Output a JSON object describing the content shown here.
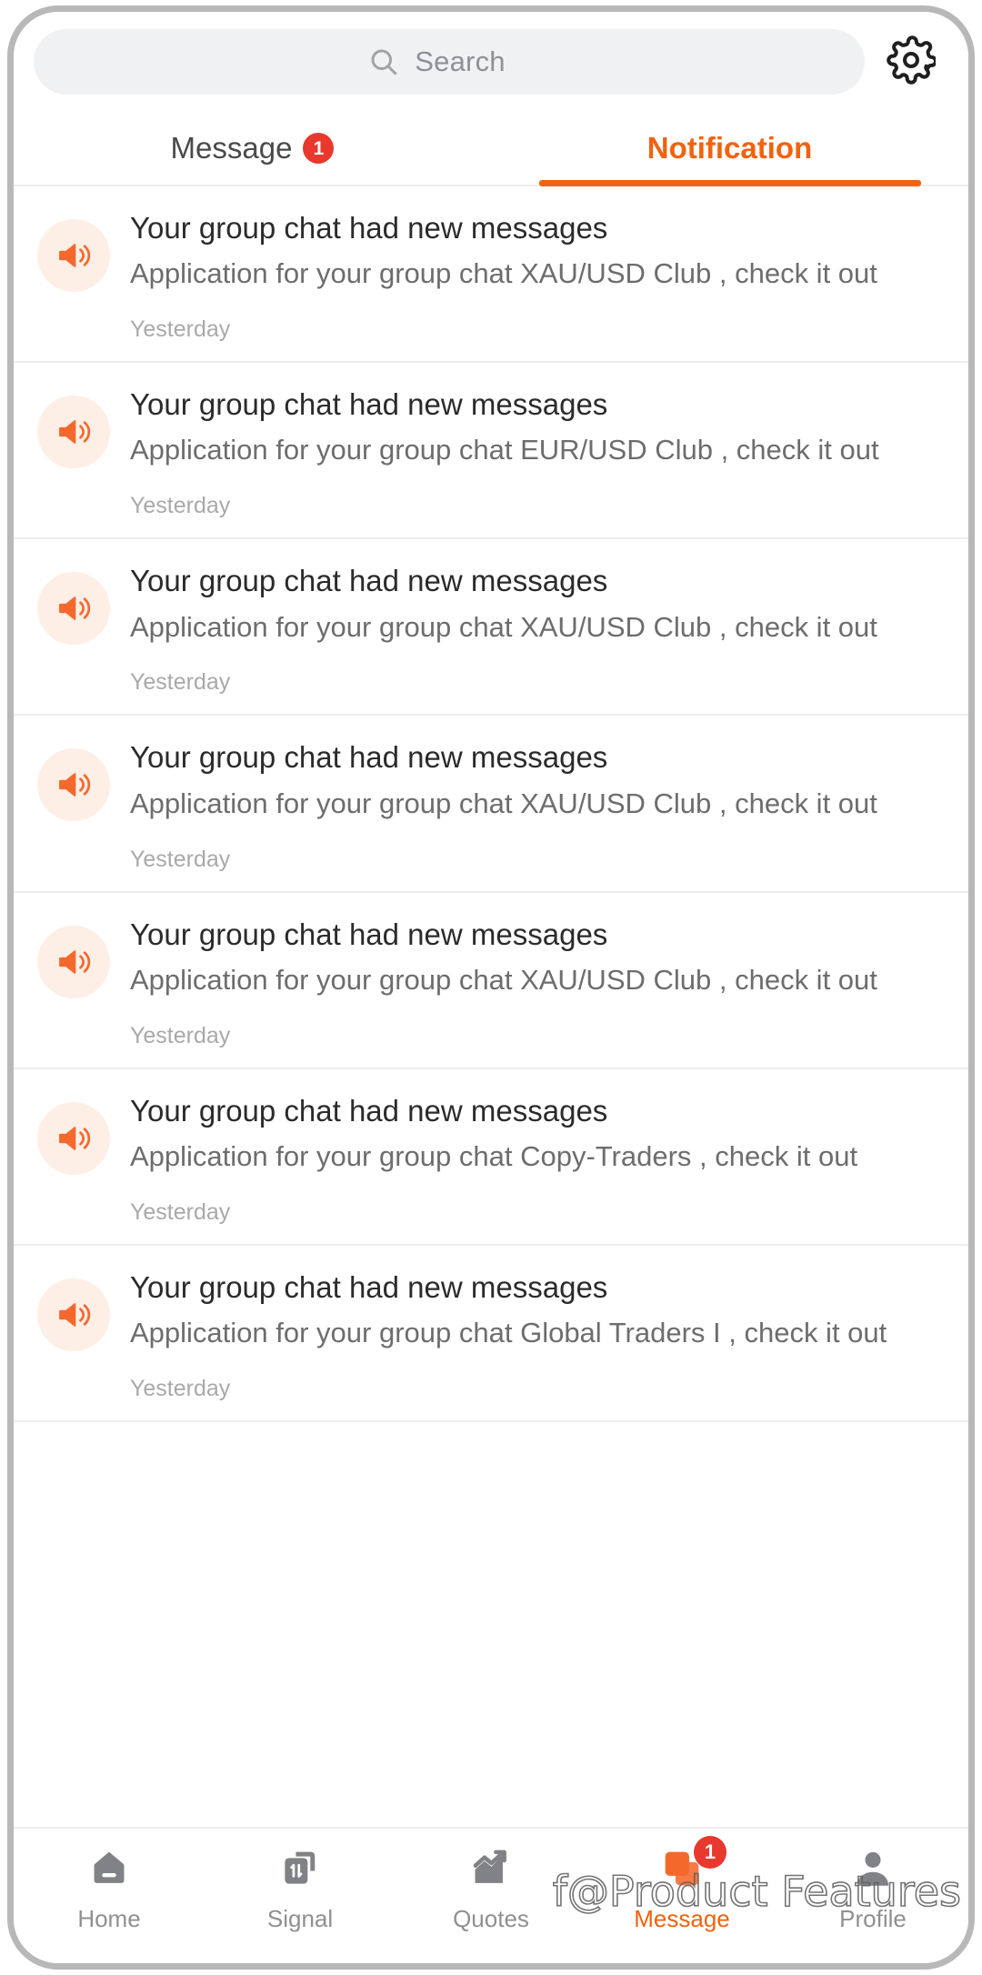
{
  "search": {
    "placeholder": "Search",
    "icon": "search-icon"
  },
  "header": {
    "settings_icon": "gear-icon"
  },
  "tabs": [
    {
      "label": "Message",
      "badge": "1",
      "active": false
    },
    {
      "label": "Notification",
      "badge": "",
      "active": true
    }
  ],
  "notifications": [
    {
      "icon": "speaker-icon",
      "title": "Your group chat had new messages",
      "description": "Application for your group chat XAU/USD Club , check it out",
      "time": "Yesterday"
    },
    {
      "icon": "speaker-icon",
      "title": "Your group chat had new messages",
      "description": "Application for your group chat EUR/USD Club , check it out",
      "time": "Yesterday"
    },
    {
      "icon": "speaker-icon",
      "title": "Your group chat had new messages",
      "description": "Application for your group chat XAU/USD Club , check it out",
      "time": "Yesterday"
    },
    {
      "icon": "speaker-icon",
      "title": "Your group chat had new messages",
      "description": "Application for your group chat XAU/USD Club , check it out",
      "time": "Yesterday"
    },
    {
      "icon": "speaker-icon",
      "title": "Your group chat had new messages",
      "description": "Application for your group chat XAU/USD Club , check it out",
      "time": "Yesterday"
    },
    {
      "icon": "speaker-icon",
      "title": "Your group chat had new messages",
      "description": "Application for your group chat Copy-Traders , check it out",
      "time": "Yesterday"
    },
    {
      "icon": "speaker-icon",
      "title": "Your group chat had new messages",
      "description": "Application for your group chat Global Traders I , check it out",
      "time": "Yesterday"
    }
  ],
  "bottom_nav": [
    {
      "label": "Home",
      "icon": "home-icon",
      "badge": "",
      "active": false
    },
    {
      "label": "Signal",
      "icon": "signal-icon",
      "badge": "",
      "active": false
    },
    {
      "label": "Quotes",
      "icon": "quotes-icon",
      "badge": "",
      "active": false
    },
    {
      "label": "Message",
      "icon": "message-icon",
      "badge": "1",
      "active": true
    },
    {
      "label": "Profile",
      "icon": "profile-icon",
      "badge": "",
      "active": false
    }
  ],
  "watermark": {
    "text": "f@Product Features"
  },
  "colors": {
    "accent": "#f2620f",
    "badge": "#e8392e",
    "icon_grey": "#808285",
    "text_primary": "#2b2b2b",
    "text_secondary": "#6d6d6d",
    "text_muted": "#a9a9a9",
    "search_bg": "#f0f1f3",
    "avatar_bg": "#fdeee6",
    "divider": "#ededed"
  }
}
